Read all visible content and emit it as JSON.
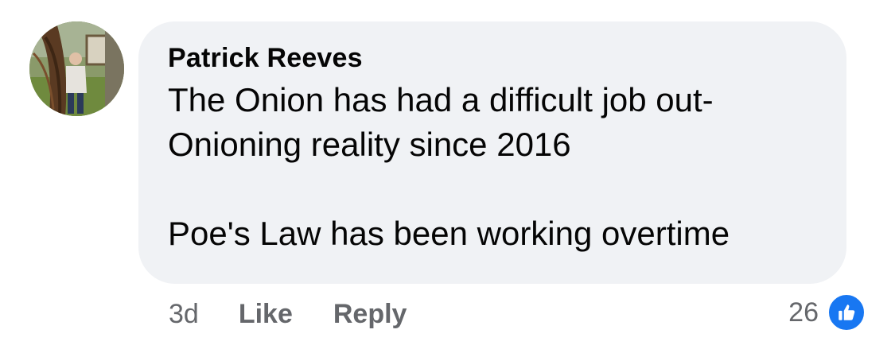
{
  "comment": {
    "author": "Patrick Reeves",
    "text": "The Onion has had a difficult job out-\nOnioning reality since 2016\n\nPoe's Law has been working overtime",
    "avatar_icon": "user-photo-avatar",
    "bubble_color": "#f0f2f5"
  },
  "actions": {
    "timestamp": "3d",
    "like_label": "Like",
    "reply_label": "Reply"
  },
  "reactions": {
    "count": "26",
    "icon": "like-thumbs-up-icon",
    "color": "#1877f2"
  }
}
